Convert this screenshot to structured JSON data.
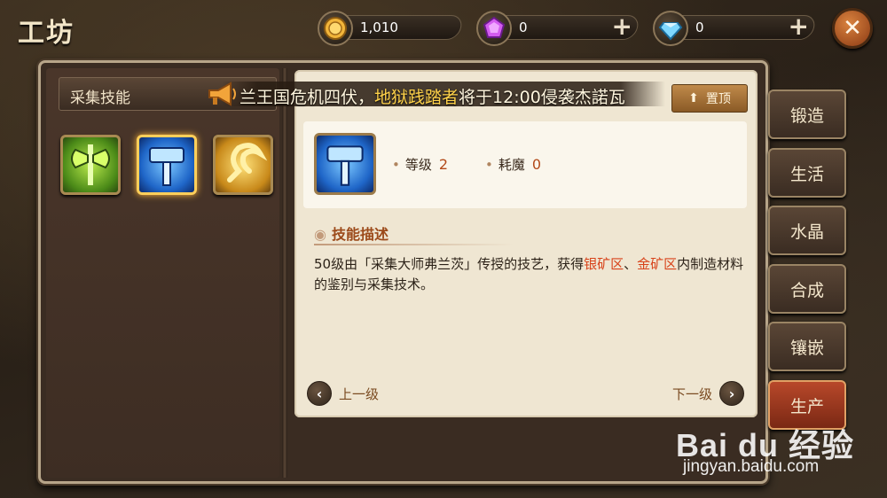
{
  "header": {
    "title": "工坊",
    "close": "✕"
  },
  "resources": [
    {
      "icon": "gold-coin-icon",
      "value": "1,010",
      "has_plus": false
    },
    {
      "icon": "purple-gem-icon",
      "value": "0",
      "has_plus": true
    },
    {
      "icon": "diamond-icon",
      "value": "0",
      "has_plus": true
    }
  ],
  "sidebar": {
    "dropdown_label": "采集技能"
  },
  "skills": [
    {
      "icon": "green-axe-icon",
      "selected": false
    },
    {
      "icon": "blue-hammer-icon",
      "selected": true
    },
    {
      "icon": "gold-sickle-icon",
      "selected": false
    }
  ],
  "notice": {
    "text_a": "兰王国危机四伏，",
    "text_b": "地狱践踏者",
    "text_c": "将于12:00侵袭杰諾瓦",
    "pin_label": "置顶"
  },
  "detail": {
    "level_label": "等级",
    "level_value": "2",
    "cost_label": "耗魔",
    "cost_value": "0",
    "desc_title": "技能描述",
    "desc_a": "50级由「采集大师弗兰茨」传授的技艺，获得",
    "desc_hl1": "银矿区",
    "desc_sep": "、",
    "desc_hl2": "金矿区",
    "desc_b": "内制造材料的鉴别与采集技术。",
    "prev_label": "上一级",
    "next_label": "下一级"
  },
  "tabs": [
    {
      "label": "锻造",
      "active": false
    },
    {
      "label": "生活",
      "active": false
    },
    {
      "label": "水晶",
      "active": false
    },
    {
      "label": "合成",
      "active": false
    },
    {
      "label": "镶嵌",
      "active": false
    },
    {
      "label": "生产",
      "active": true
    }
  ],
  "watermark": {
    "logo": "Bai du 经验",
    "url": "jingyan.baidu.com"
  },
  "colors": {
    "accent_red": "#d8431a",
    "gold": "#ffd24a",
    "panel_bg": "#3a2c22",
    "card_bg": "#efe6d2"
  }
}
